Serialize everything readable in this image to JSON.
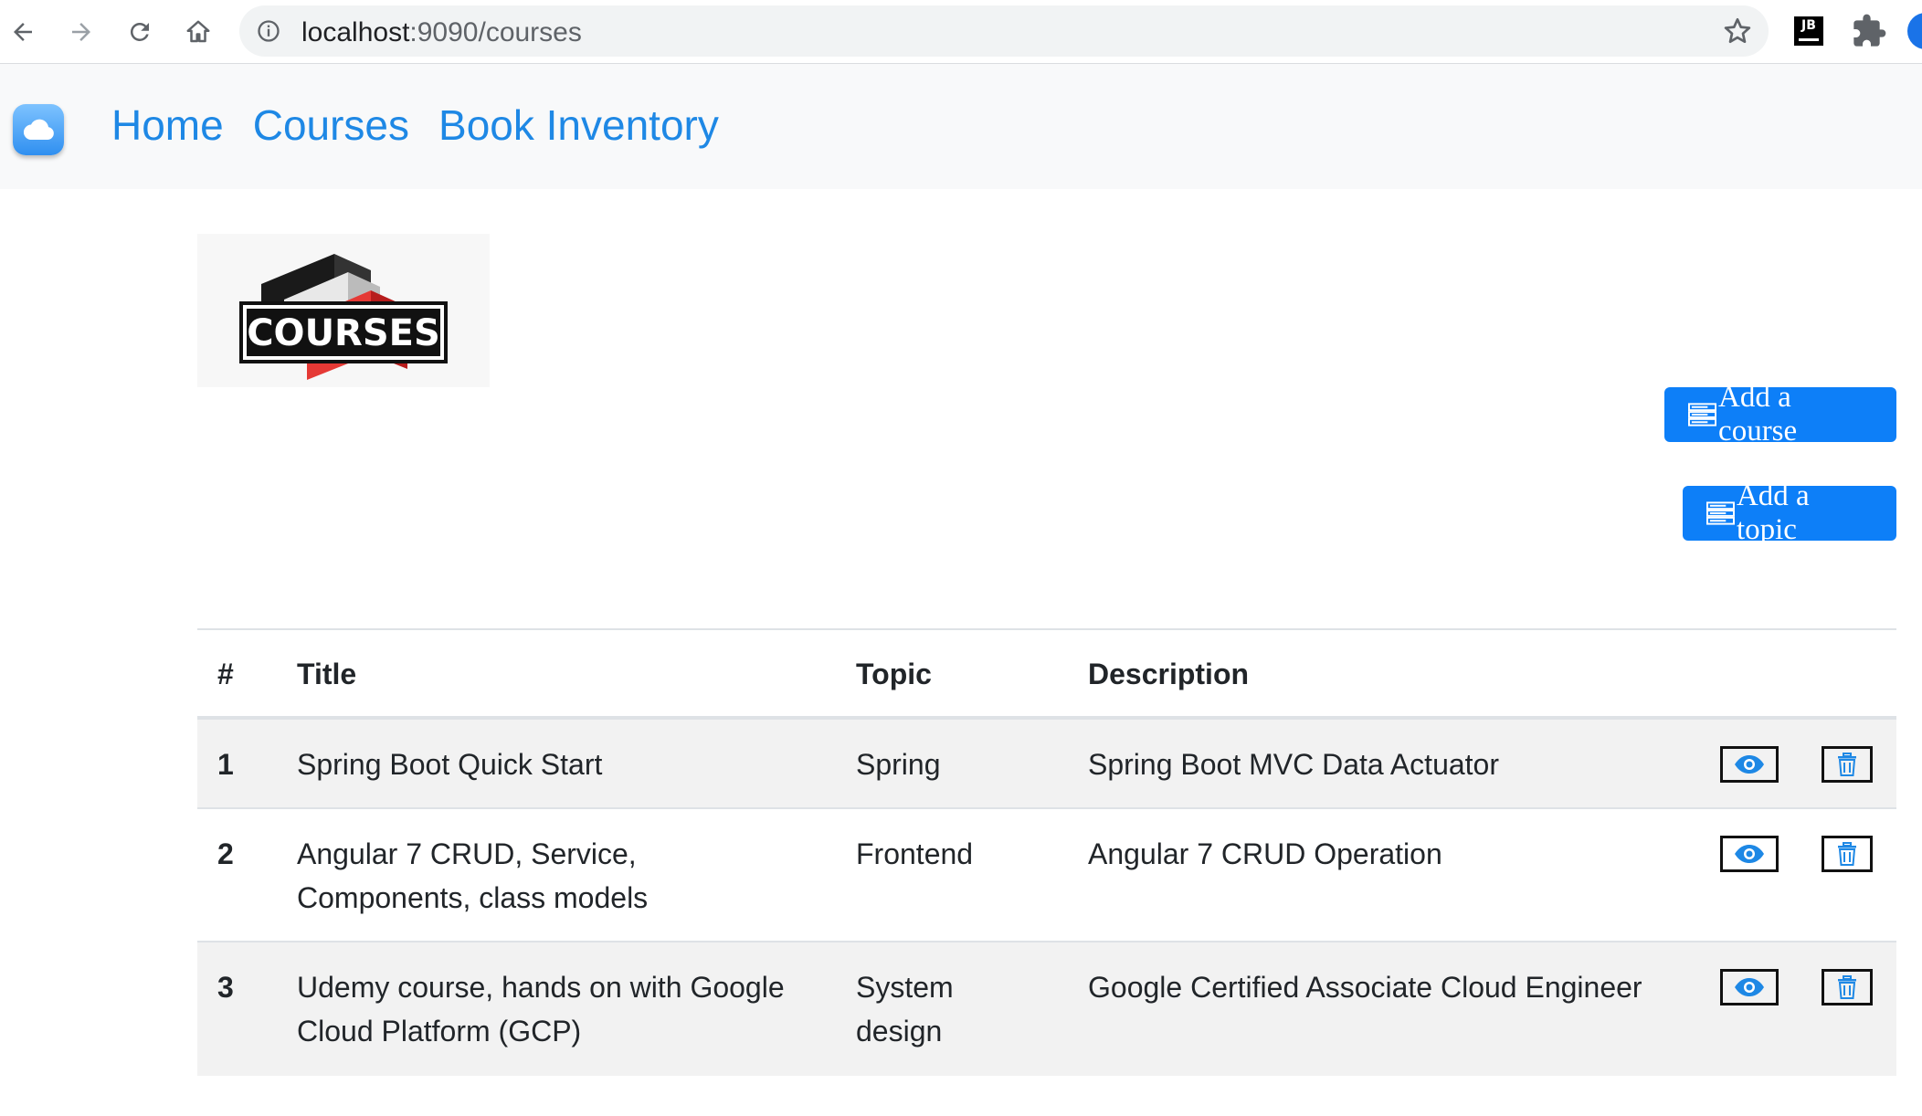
{
  "browser": {
    "url_host": "localhost",
    "url_path": ":9090/courses",
    "extension_jb_label": "JB"
  },
  "navbar": {
    "links": [
      "Home",
      "Courses",
      "Book Inventory"
    ]
  },
  "logo": {
    "text": "COURSES"
  },
  "actions": {
    "add_course": "Add a course",
    "add_topic": "Add a topic"
  },
  "table": {
    "headers": [
      "#",
      "Title",
      "Topic",
      "Description"
    ],
    "rows": [
      {
        "id": "1",
        "title_lines": [
          "Spring Boot Quick Start"
        ],
        "topic_lines": [
          "Spring"
        ],
        "description": "Spring Boot MVC Data Actuator"
      },
      {
        "id": "2",
        "title_lines": [
          "Angular 7 CRUD, Service,",
          "Components, class models"
        ],
        "topic_lines": [
          "Frontend"
        ],
        "description": "Angular 7 CRUD Operation"
      },
      {
        "id": "3",
        "title_lines": [
          "Udemy course, hands on with Google",
          "Cloud Platform (GCP)"
        ],
        "topic_lines": [
          "System",
          "design"
        ],
        "description": "Google Certified Associate Cloud Engineer"
      }
    ]
  },
  "colors": {
    "link": "#1e88e5",
    "primary_button": "#0d7ff8",
    "icon_blue": "#1e88e5",
    "stripe": "#f2f2f2"
  },
  "icons": {
    "back": "arrow-left-icon",
    "forward": "arrow-right-icon",
    "reload": "reload-icon",
    "home": "home-icon",
    "site_info": "info-icon",
    "bookmark": "star-icon",
    "extensions": "puzzle-icon",
    "brand": "cloud-icon",
    "view": "eye-icon",
    "delete": "trash-icon",
    "button_prefix": "server-icon"
  }
}
